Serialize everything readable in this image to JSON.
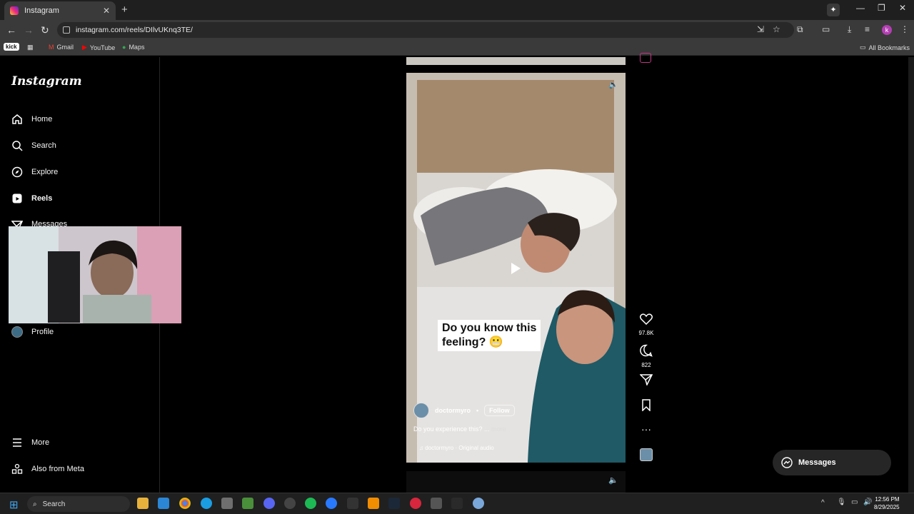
{
  "browser": {
    "tab_title": "Instagram",
    "url": "instagram.com/reels/DIlvUKnq3TE/",
    "bookmarks": [
      "Gmail",
      "YouTube",
      "Maps"
    ],
    "all_bookmarks": "All Bookmarks",
    "kick": "kick",
    "profile_initial": "k"
  },
  "sidebar": {
    "logo": "Instagram",
    "items": [
      {
        "label": "Home",
        "icon": "home-icon"
      },
      {
        "label": "Search",
        "icon": "search-icon"
      },
      {
        "label": "Explore",
        "icon": "compass-icon"
      },
      {
        "label": "Reels",
        "icon": "reels-icon"
      },
      {
        "label": "Messages",
        "icon": "send-icon"
      },
      {
        "label": "Profile",
        "icon": "avatar-icon"
      },
      {
        "label": "More",
        "icon": "menu-icon"
      },
      {
        "label": "Also from Meta",
        "icon": "meta-apps-icon"
      }
    ]
  },
  "reel": {
    "caption_overlay_line1": "Do you know this",
    "caption_overlay_line2": "feeling? 😬",
    "username": "doctormyro",
    "follow": "Follow",
    "separator": "•",
    "description": "Do you experience this? ...",
    "more": "more",
    "audio": "doctormyro · Original audio"
  },
  "actions": {
    "likes": "97.8K",
    "comments": "822"
  },
  "messages_button": "Messages",
  "taskbar": {
    "search": "Search",
    "time": "12:56 PM",
    "date": "8/29/2025"
  },
  "colors": {
    "accent": "#0095f6",
    "background": "#000000"
  }
}
